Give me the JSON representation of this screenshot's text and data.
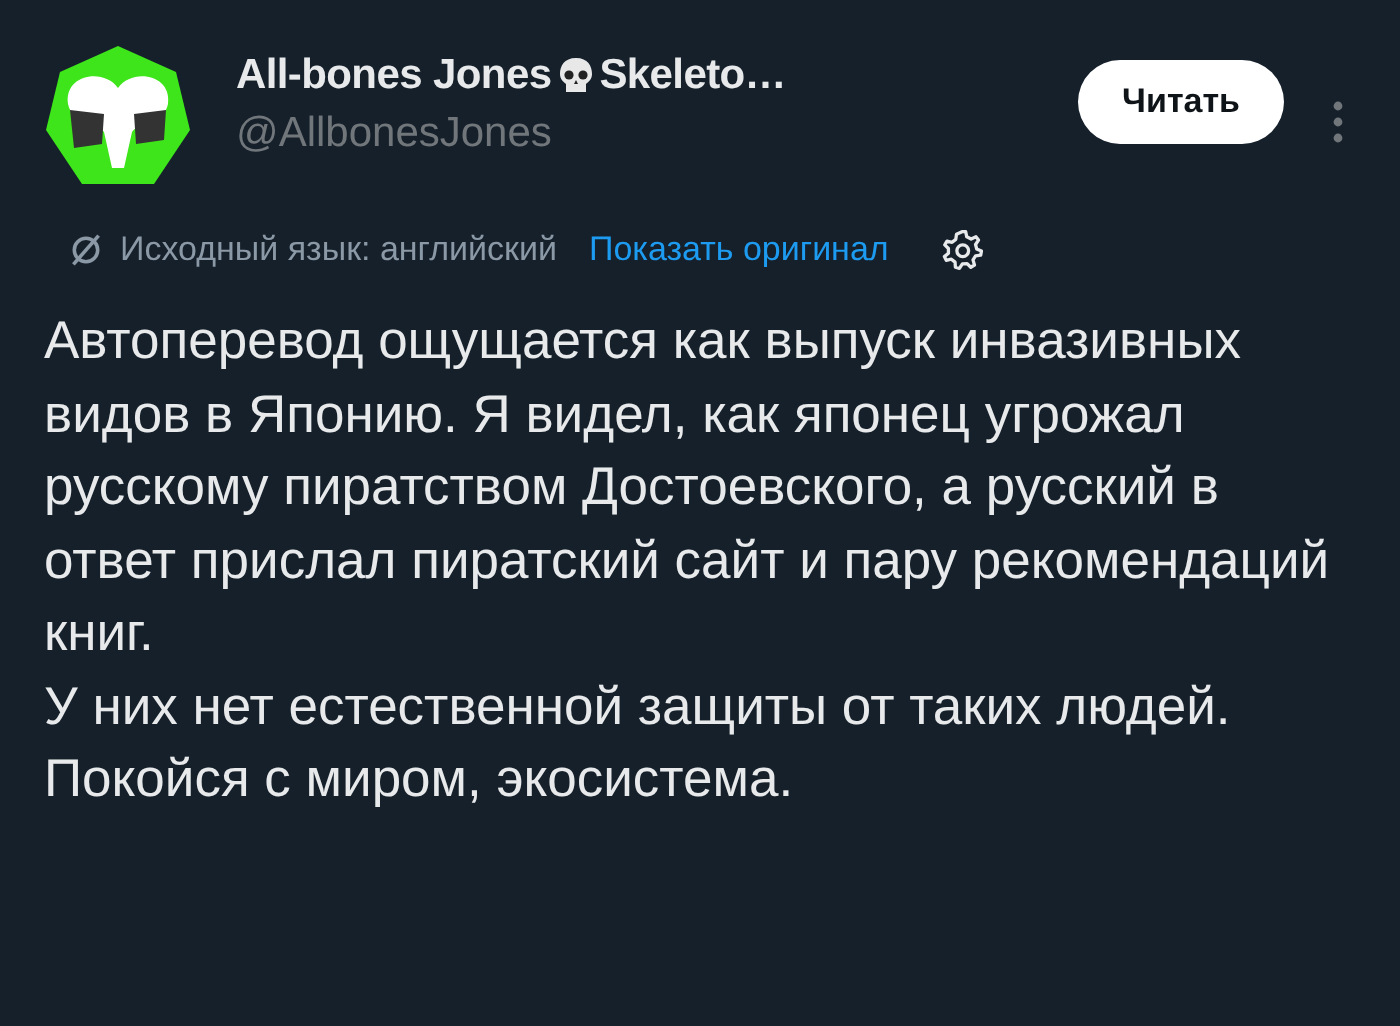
{
  "author": {
    "name": "All-bones Jones",
    "name_suffix": "Skeleto…",
    "handle": "@AllbonesJones"
  },
  "follow_button": {
    "label": "Читать"
  },
  "translation": {
    "note": "Исходный язык: английский",
    "link": "Показать оригинал"
  },
  "post_text": [
    "Автоперевод ощущается как выпуск инвазивных видов в Японию. Я видел, как японец угрожал русскому пиратством Достоевского, а русский в ответ прислал пиратский сайт и пару рекомендаций книг.",
    "У них нет естественной защиты от таких людей. Покойся с миром, экосистема."
  ]
}
